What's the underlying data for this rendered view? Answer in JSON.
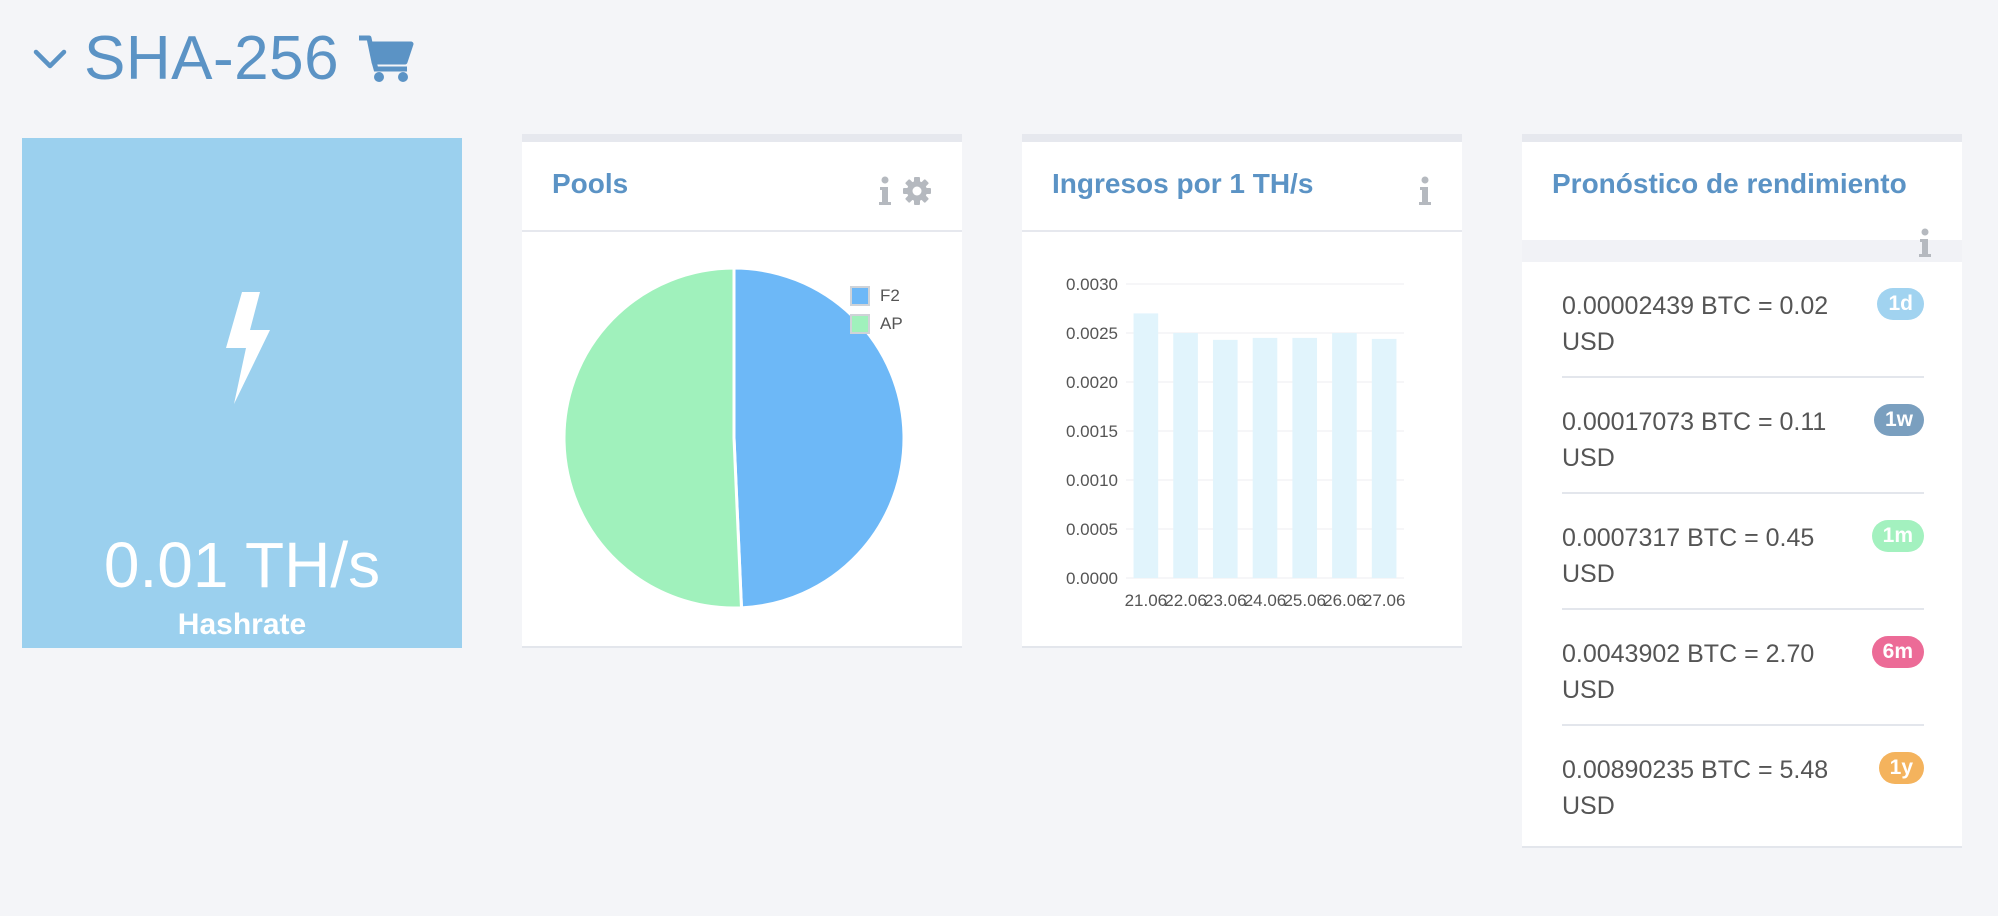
{
  "header": {
    "title": "SHA-256"
  },
  "hashrate": {
    "value": "0.01 TH/s",
    "label": "Hashrate"
  },
  "pools": {
    "title": "Pools",
    "legend": [
      {
        "name": "F2",
        "color": "#6db8f7"
      },
      {
        "name": "AP",
        "color": "#a0f1bc"
      }
    ]
  },
  "income": {
    "title": "Ingresos por 1 TH/s"
  },
  "forecast": {
    "title": "Pronóstico de rendimiento",
    "rows": [
      {
        "text": "0.00002439 BTC = 0.02 USD",
        "badge": "1d",
        "color": "#a1d3f0"
      },
      {
        "text": "0.00017073 BTC = 0.11 USD",
        "badge": "1w",
        "color": "#7a9fbf"
      },
      {
        "text": "0.0007317 BTC = 0.45 USD",
        "badge": "1m",
        "color": "#a3f1bf"
      },
      {
        "text": "0.0043902 BTC = 2.70 USD",
        "badge": "6m",
        "color": "#ec6b97"
      },
      {
        "text": "0.00890235 BTC = 5.48 USD",
        "badge": "1y",
        "color": "#f4b35d"
      }
    ]
  },
  "chart_data": [
    {
      "type": "pie",
      "categories": [
        "F2",
        "AP"
      ],
      "values": [
        49.3,
        50.7
      ],
      "colors": [
        "#6db8f7",
        "#a0f1bc"
      ],
      "legend": "top-right"
    },
    {
      "type": "bar",
      "categories": [
        "21.06",
        "22.06",
        "23.06",
        "24.06",
        "25.06",
        "26.06",
        "27.06"
      ],
      "values": [
        0.0027,
        0.0025,
        0.00243,
        0.00245,
        0.00245,
        0.0025,
        0.00244
      ],
      "ylim": [
        0,
        0.003
      ],
      "yticks": [
        "0.0000",
        "0.0005",
        "0.0010",
        "0.0015",
        "0.0020",
        "0.0025",
        "0.0030"
      ],
      "grid": true,
      "color": "#e1f4fc"
    }
  ]
}
